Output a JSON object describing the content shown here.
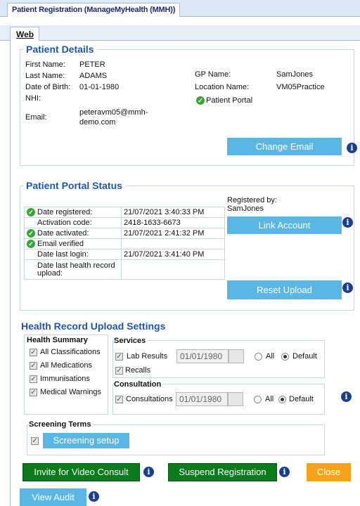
{
  "window": {
    "title": "Patient Registration (ManageMyHealth (MMH))"
  },
  "tabs": {
    "web": "Web"
  },
  "patient_details": {
    "title": "Patient Details",
    "first_name_label": "First Name:",
    "first_name": "PETER",
    "last_name_label": "Last Name:",
    "last_name": "ADAMS",
    "dob_label": "Date of Birth:",
    "dob": "01-01-1980",
    "nhi_label": "NHI:",
    "nhi": "",
    "email_label": "Email:",
    "email_line1": "peteravm05@mmh-",
    "email_line2": "demo.com",
    "gp_label": "GP Name:",
    "gp": "SamJones",
    "location_label": "Location Name:",
    "location": "VM05Practice",
    "portal_label": "Patient Portal",
    "change_email": "Change Email"
  },
  "portal_status": {
    "title": "Patient Portal Status",
    "registered_by_label": "Registered by:",
    "registered_by": "SamJones",
    "rows": [
      {
        "label": "Date registered:",
        "value": "21/07/2021 3:40:33 PM",
        "check": true
      },
      {
        "label": "Activation code:",
        "value": "2418-1633-6673",
        "check": false
      },
      {
        "label": "Date activated:",
        "value": "21/07/2021 2:41:32 PM",
        "check": true
      },
      {
        "label": "Email verified",
        "value": "",
        "check": true
      },
      {
        "label": "Date last login:",
        "value": "21/07/2021 3:41:40 PM",
        "check": false
      },
      {
        "label": "Date last health record upload:",
        "value": "",
        "check": false
      }
    ],
    "link_account": "Link Account",
    "reset_upload": "Reset Upload"
  },
  "upload_settings": {
    "title": "Health Record Upload Settings",
    "health_summary_title": "Health Summary",
    "health_summary": [
      "All Classifications",
      "All Medications",
      "Immunisations",
      "Medical Warnings"
    ],
    "services_title": "Services",
    "lab_results": "Lab Results",
    "lab_date": "01/01/1980",
    "recalls": "Recalls",
    "consultation_title": "Consultation",
    "consultations": "Consultations",
    "consult_date": "01/01/1980",
    "all_label": "All",
    "default_label": "Default",
    "screening_title": "Screening Terms",
    "screening_setup": "Screening setup"
  },
  "footer": {
    "invite_video": "Invite for Video Consult",
    "suspend": "Suspend Registration",
    "close": "Close",
    "view_audit": "View Audit"
  },
  "colors": {
    "accent_blue": "#5ab7e4",
    "green": "#0b7a1d",
    "orange": "#f7a21b",
    "title_blue": "#1f56a8"
  }
}
